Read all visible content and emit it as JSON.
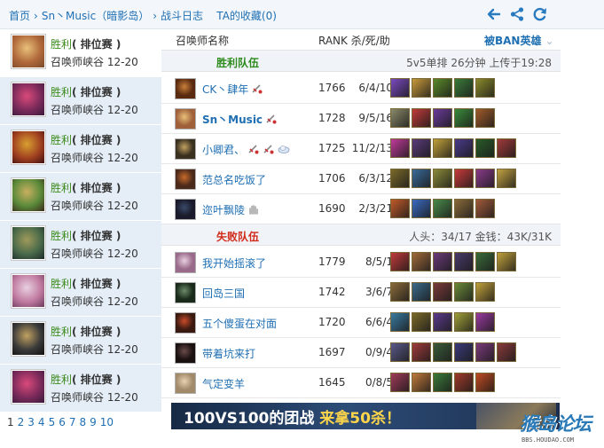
{
  "breadcrumb": {
    "home": "首页",
    "player": "Sn丶Music（暗影岛）",
    "battle_log": "战斗日志",
    "favorites": "TA的收藏(0)"
  },
  "toolbar_icons": [
    "arrow-left-icon",
    "share-icon",
    "refresh-icon"
  ],
  "history": [
    {
      "result": "胜利",
      "mode": "( 排位赛 )",
      "map": "召唤师峡谷",
      "date": "12-20",
      "champ_colors": [
        "#e8c07a",
        "#b0683a",
        "#7a4a2a"
      ]
    },
    {
      "result": "胜利",
      "mode": "( 排位赛 )",
      "map": "召唤师峡谷",
      "date": "12-20",
      "champ_colors": [
        "#d94a7a",
        "#7a2a5a",
        "#3a1a3a"
      ]
    },
    {
      "result": "胜利",
      "mode": "( 排位赛 )",
      "map": "召唤师峡谷",
      "date": "12-20",
      "champ_colors": [
        "#d8a030",
        "#a04020",
        "#401010"
      ]
    },
    {
      "result": "胜利",
      "mode": "( 排位赛 )",
      "map": "召唤师峡谷",
      "date": "12-20",
      "champ_colors": [
        "#c8b060",
        "#5a8a3a",
        "#3a2a1a"
      ]
    },
    {
      "result": "胜利",
      "mode": "( 排位赛 )",
      "map": "召唤师峡谷",
      "date": "12-20",
      "champ_colors": [
        "#a09a5a",
        "#4a6a4a",
        "#1a2a2a"
      ]
    },
    {
      "result": "胜利",
      "mode": "( 排位赛 )",
      "map": "召唤师峡谷",
      "date": "12-20",
      "champ_colors": [
        "#e8d0e0",
        "#c07aa0",
        "#6a3a5a"
      ]
    },
    {
      "result": "胜利",
      "mode": "( 排位赛 )",
      "map": "召唤师峡谷",
      "date": "12-20",
      "champ_colors": [
        "#c0a060",
        "#3a3a3a",
        "#101010"
      ]
    },
    {
      "result": "胜利",
      "mode": "( 排位赛 )",
      "map": "召唤师峡谷",
      "date": "12-20",
      "champ_colors": [
        "#d94a7a",
        "#7a2a5a",
        "#3a1a3a"
      ]
    }
  ],
  "pager": [
    "1",
    "2",
    "3",
    "4",
    "5",
    "6",
    "7",
    "8",
    "9",
    "10"
  ],
  "columns": {
    "summoner": "召唤师名称",
    "rank_kda": "RANK 杀/死/助",
    "banned": "被BAN英雄"
  },
  "win_team": {
    "label": "胜利队伍",
    "info": "5v5单排 26分钟 上传于19:28",
    "players": [
      {
        "name": "CK丶肆年",
        "rank": "1766",
        "kda": "6/4/10",
        "is_me": false,
        "tags": [
          "sword-icon"
        ],
        "avatar": [
          "#c8803a",
          "#5a2a10"
        ],
        "items": [
          "#7a4ac0",
          "#c89a3a",
          "#5a8a2a",
          "#3a7a3a",
          "#8a8a2a"
        ]
      },
      {
        "name": "Sn丶Music",
        "rank": "1728",
        "kda": "9/5/16",
        "is_me": true,
        "tags": [
          "sword-icon"
        ],
        "avatar": [
          "#e8c07a",
          "#a0603a"
        ],
        "items": [
          "#8a8a6a",
          "#c03a3a",
          "#6a3a9a",
          "#3a8a3a",
          "#a05a2a"
        ]
      },
      {
        "name": "小卿君、",
        "rank": "1725",
        "kda": "11/2/13",
        "is_me": false,
        "tags": [
          "sword-icon",
          "sword-icon",
          "cloud-icon"
        ],
        "avatar": [
          "#c0a060",
          "#3a3020"
        ],
        "items": [
          "#c03a9a",
          "#5a3a7a",
          "#c0a03a",
          "#4a3a8a",
          "#2a5a2a",
          "#a03a3a"
        ]
      },
      {
        "name": "范总名吃饭了",
        "rank": "1706",
        "kda": "6/3/12",
        "is_me": false,
        "tags": [],
        "avatar": [
          "#c86a2a",
          "#4a2a1a"
        ],
        "items": [
          "#7a6a2a",
          "#3a6a9a",
          "#8a8a3a",
          "#c83a3a",
          "#8a3a8a",
          "#c0a040"
        ]
      },
      {
        "name": "迩叶飘陵",
        "rank": "1690",
        "kda": "2/3/21",
        "is_me": false,
        "tags": [
          "hand-icon"
        ],
        "avatar": [
          "#3a4a6a",
          "#1a1a2a"
        ],
        "items": [
          "#c05a2a",
          "#3a6ac0",
          "#4a8a4a",
          "#8a6a3a",
          "#a05a3a"
        ]
      }
    ]
  },
  "lose_team": {
    "label": "失败队伍",
    "info": "人头：34/17 金钱：43K/31K",
    "players": [
      {
        "name": "我开始摇滚了",
        "rank": "1779",
        "kda": "8/5/1",
        "is_me": false,
        "tags": [],
        "avatar": [
          "#e8d0e0",
          "#9a6a8a"
        ],
        "items": [
          "#c03a3a",
          "#a06a3a",
          "#6a3a7a",
          "#4a3a6a",
          "#3a6a3a",
          "#c0a03a"
        ]
      },
      {
        "name": "回岛三国",
        "rank": "1742",
        "kda": "3/6/7",
        "is_me": false,
        "tags": [],
        "avatar": [
          "#6a8a6a",
          "#1a2a1a"
        ],
        "items": [
          "#8a6a3a",
          "#3a6a8a",
          "#7a3a3a",
          "#6a8a3a",
          "#c0a03a"
        ]
      },
      {
        "name": "五个傻蛋在对面",
        "rank": "1720",
        "kda": "6/6/4",
        "is_me": false,
        "tags": [],
        "avatar": [
          "#c84a2a",
          "#3a1a10"
        ],
        "items": [
          "#3a7aa0",
          "#7a6a2a",
          "#5a3a8a",
          "#a0a03a",
          "#9a3aa0"
        ]
      },
      {
        "name": "带着坑来打",
        "rank": "1697",
        "kda": "0/9/4",
        "is_me": false,
        "tags": [],
        "avatar": [
          "#6a4a4a",
          "#1a1010"
        ],
        "items": [
          "#5a5a8a",
          "#a03a3a",
          "#3a5a3a",
          "#3a3a7a",
          "#7a3a7a",
          "#8a3a3a"
        ]
      },
      {
        "name": "气定变羊",
        "rank": "1645",
        "kda": "0/8/5",
        "is_me": false,
        "tags": [],
        "avatar": [
          "#e8d0b0",
          "#a08a6a"
        ],
        "items": [
          "#a03a5a",
          "#c07a3a",
          "#3a7a3a",
          "#a03a2a",
          "#c04a20"
        ]
      }
    ]
  },
  "banner": {
    "text_a": "100VS100的团战",
    "text_b": "来拿50杀！"
  },
  "watermark": {
    "title": "猴岛论坛",
    "url": "BBS.HOUDAO.COM"
  }
}
